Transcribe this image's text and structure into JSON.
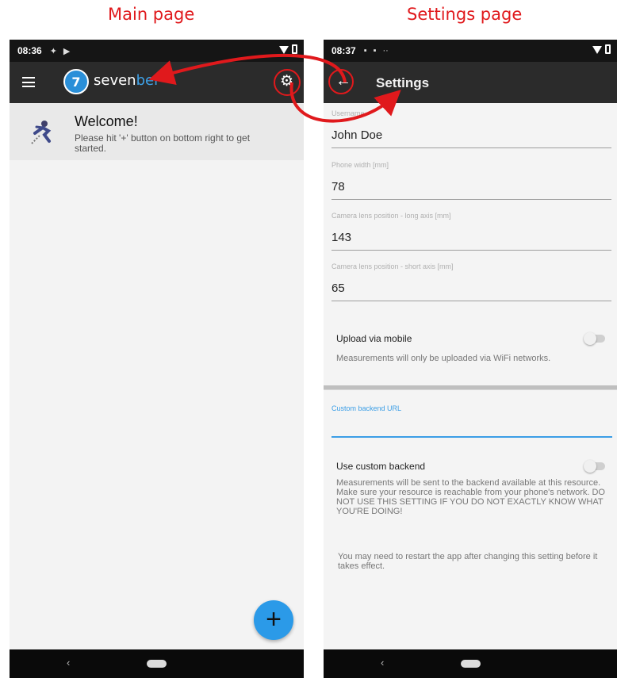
{
  "captions": {
    "main": "Main page",
    "settings": "Settings page"
  },
  "main_page": {
    "status_time": "08:36",
    "app_name_part1": "seven",
    "app_name_part2": "bel",
    "logo_glyph": "7",
    "welcome_title": "Welcome!",
    "welcome_text": "Please hit '+' button on bottom right to get started.",
    "fab_label": "+"
  },
  "settings_page": {
    "status_time": "08:37",
    "title": "Settings",
    "fields": [
      {
        "label": "Username",
        "value": "John Doe"
      },
      {
        "label": "Phone width [mm]",
        "value": "78"
      },
      {
        "label": "Camera lens position - long axis [mm]",
        "value": "143"
      },
      {
        "label": "Camera lens position - short axis [mm]",
        "value": "65"
      }
    ],
    "upload_mobile": {
      "title": "Upload via mobile",
      "description": "Measurements will only be uploaded via WiFi networks.",
      "enabled": false
    },
    "custom_backend_url": {
      "label": "Custom backend URL",
      "value": ""
    },
    "use_custom_backend": {
      "title": "Use custom backend",
      "description": "Measurements will be sent to the backend available at this resource. Make sure your resource is reachable from your phone's network. DO NOT USE THIS SETTING IF YOU DO NOT EXACTLY KNOW WHAT YOU'RE DOING!",
      "enabled": false
    },
    "restart_note": "You may need to restart the app after changing this setting before it takes effect."
  },
  "icons": {
    "menu": "hamburger-icon",
    "settings": "gear-icon",
    "back": "back-arrow-icon",
    "nav_back": "nav-back-icon",
    "nav_home": "nav-home-pill",
    "welcome": "runner-icon",
    "annotation": "curved-arrow-icon"
  },
  "colors": {
    "caption": "#e0191c",
    "appbar": "#2b2b2b",
    "accent": "#2b9ae8",
    "logo_blue": "#3ea2e8",
    "annotation": "#e0191c"
  }
}
